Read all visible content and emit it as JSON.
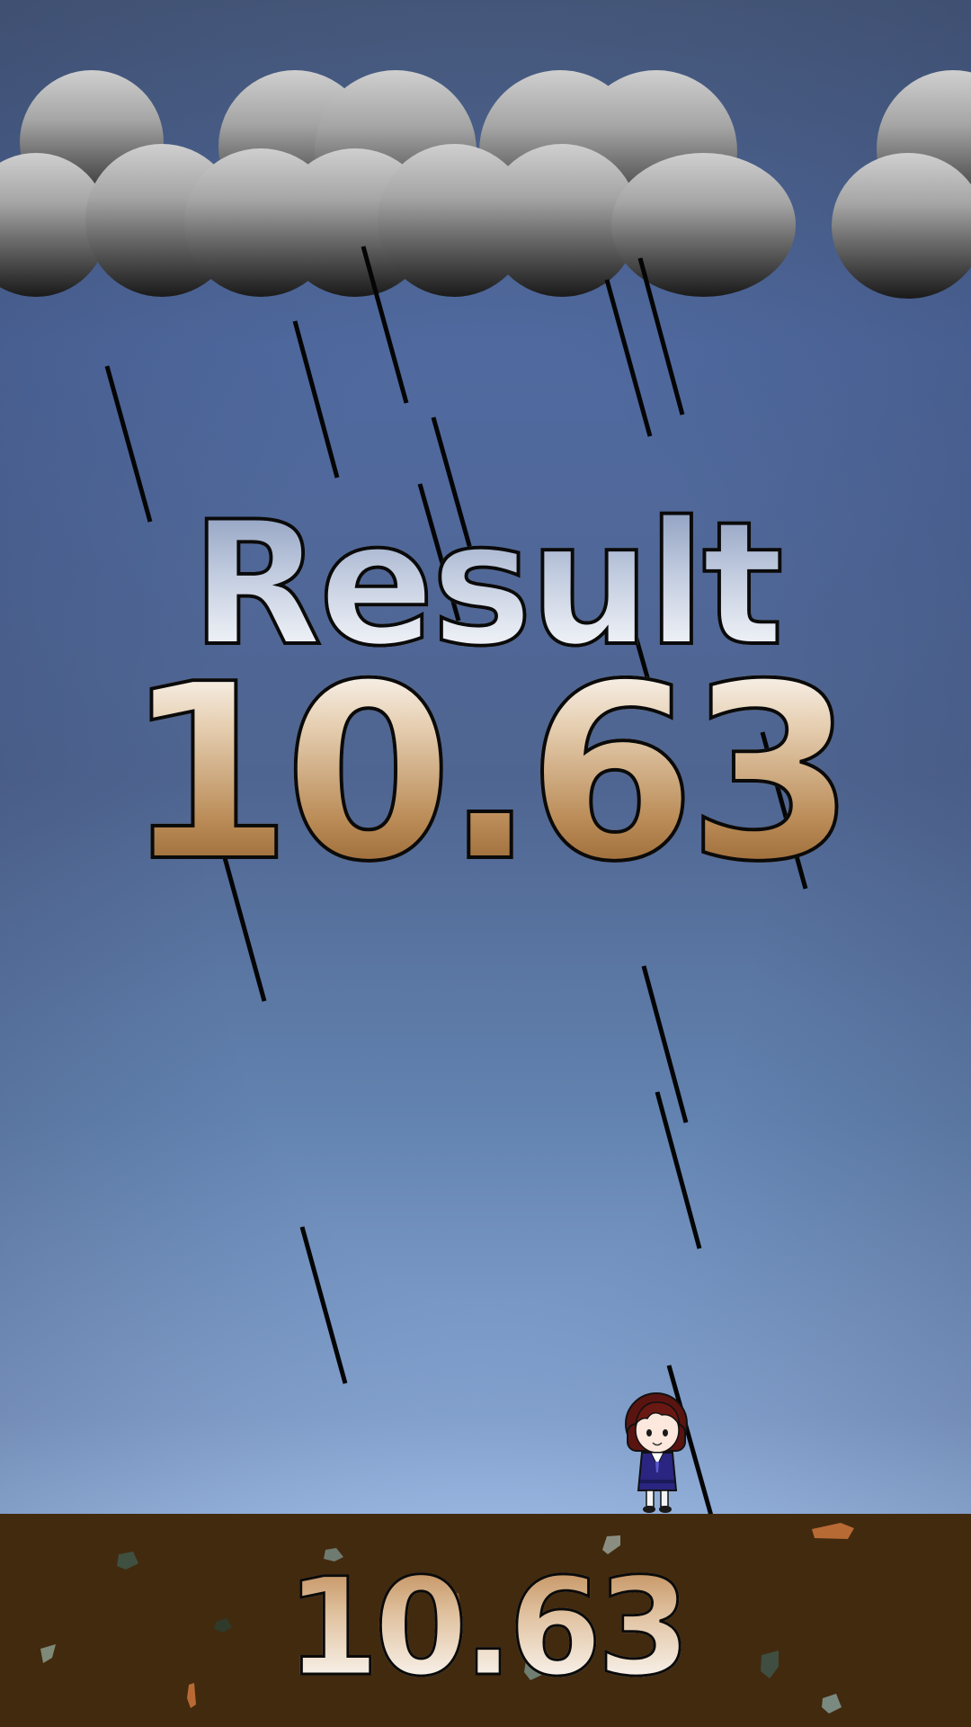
{
  "scene": {
    "result_label": "Result",
    "score": "10.63",
    "ground_score": "10.63"
  },
  "colors": {
    "sky_top": "#4a5d80",
    "sky_bottom": "#a0c0eb",
    "ground": "#422a0f",
    "rain": "#050505",
    "score_brown": "#8c5a28"
  },
  "sprites": {
    "clouds": "storm-cloud",
    "character": "schoolgirl-character",
    "ground_rocks": "rock-fragments"
  }
}
